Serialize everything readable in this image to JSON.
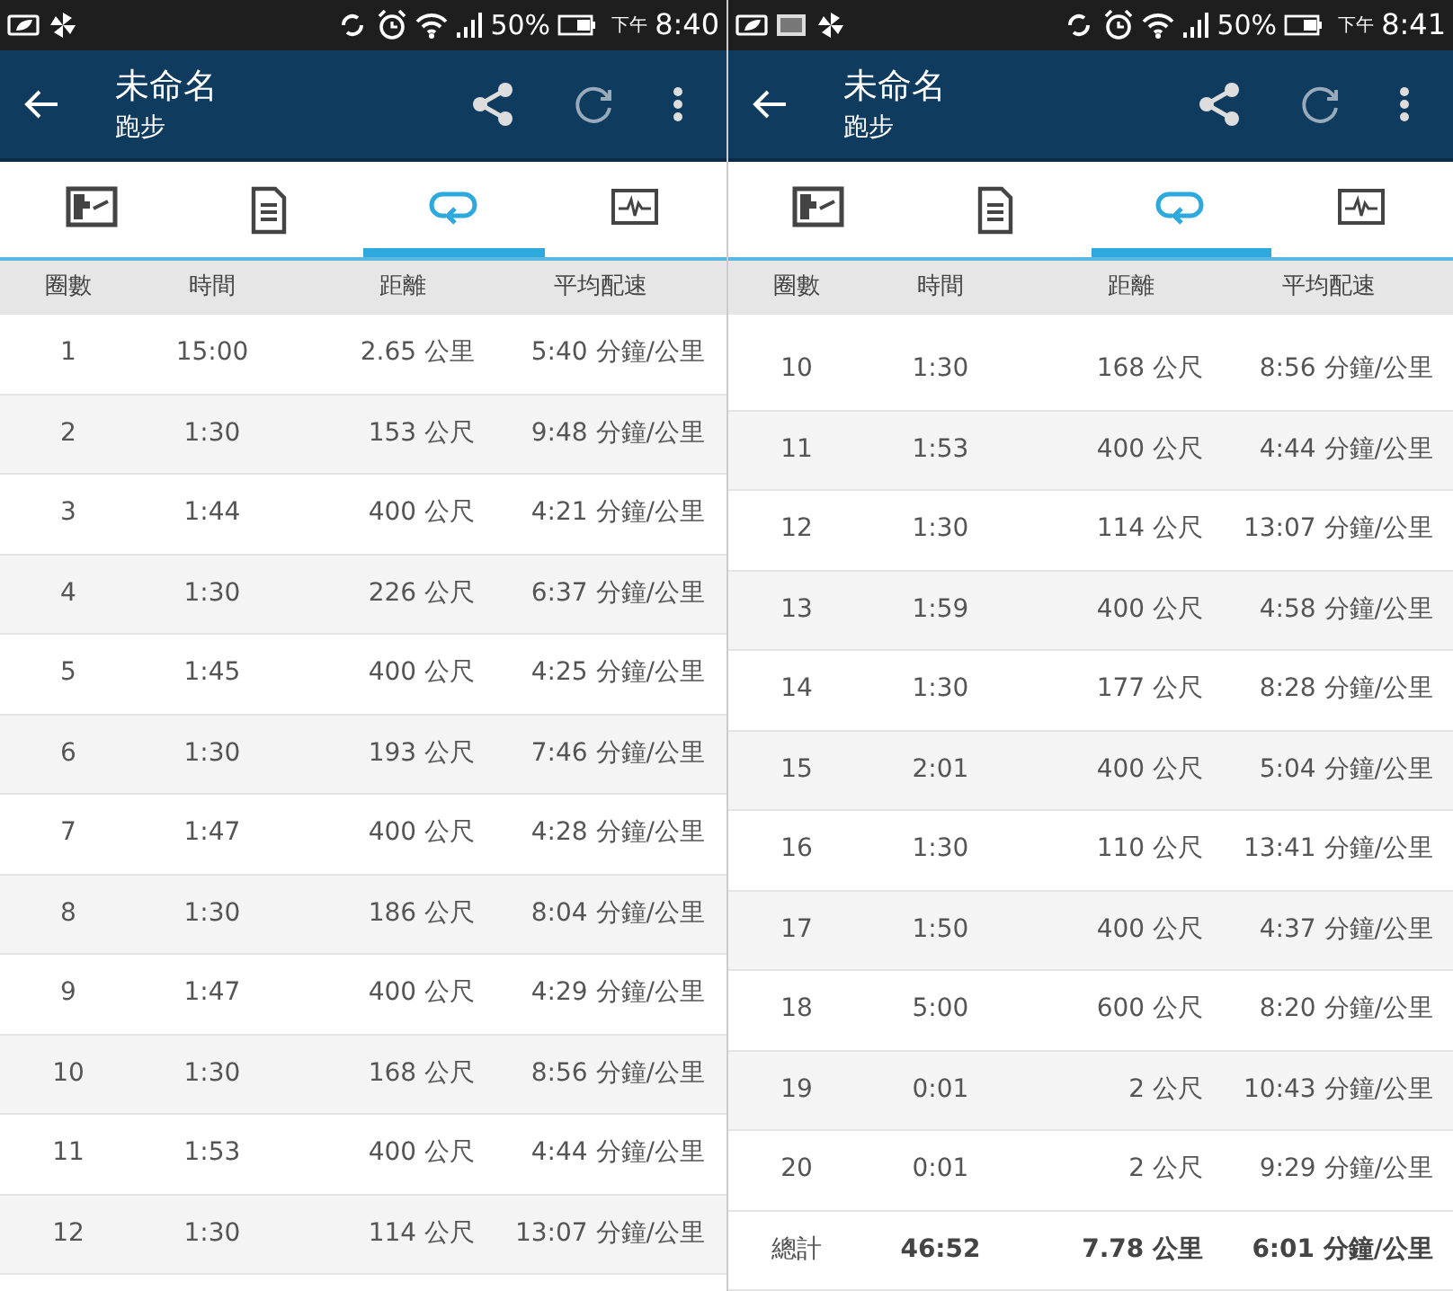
{
  "panels": [
    {
      "status_bar": {
        "notifications": [
          {
            "kind": "leaf-battery"
          },
          {
            "kind": "pinwheel"
          }
        ],
        "battery": "50%",
        "time_prefix": "下午",
        "time": "8:40"
      },
      "title": "未命名",
      "subtitle": "跑步",
      "tabs": [
        {
          "kind": "map",
          "selected": false
        },
        {
          "kind": "document",
          "selected": false
        },
        {
          "kind": "laps",
          "selected": true
        },
        {
          "kind": "chart",
          "selected": false
        }
      ],
      "columns": [
        "圈數",
        "時間",
        "距離",
        "平均配速"
      ],
      "scrolled": false,
      "rows": [
        [
          "1",
          "15:00",
          "2.65 公里",
          "5:40 分鐘/公里"
        ],
        [
          "2",
          "1:30",
          "153 公尺",
          "9:48 分鐘/公里"
        ],
        [
          "3",
          "1:44",
          "400 公尺",
          "4:21 分鐘/公里"
        ],
        [
          "4",
          "1:30",
          "226 公尺",
          "6:37 分鐘/公里"
        ],
        [
          "5",
          "1:45",
          "400 公尺",
          "4:25 分鐘/公里"
        ],
        [
          "6",
          "1:30",
          "193 公尺",
          "7:46 分鐘/公里"
        ],
        [
          "7",
          "1:47",
          "400 公尺",
          "4:28 分鐘/公里"
        ],
        [
          "8",
          "1:30",
          "186 公尺",
          "8:04 分鐘/公里"
        ],
        [
          "9",
          "1:47",
          "400 公尺",
          "4:29 分鐘/公里"
        ],
        [
          "10",
          "1:30",
          "168 公尺",
          "8:56 分鐘/公里"
        ],
        [
          "11",
          "1:53",
          "400 公尺",
          "4:44 分鐘/公里"
        ],
        [
          "12",
          "1:30",
          "114 公尺",
          "13:07 分鐘/公里"
        ]
      ]
    },
    {
      "status_bar": {
        "notifications": [
          {
            "kind": "leaf-battery"
          },
          {
            "kind": "image"
          },
          {
            "kind": "pinwheel"
          }
        ],
        "battery": "50%",
        "time_prefix": "下午",
        "time": "8:41"
      },
      "title": "未命名",
      "subtitle": "跑步",
      "tabs": [
        {
          "kind": "map",
          "selected": false
        },
        {
          "kind": "document",
          "selected": false
        },
        {
          "kind": "laps",
          "selected": true
        },
        {
          "kind": "chart",
          "selected": false
        }
      ],
      "columns": [
        "圈數",
        "時間",
        "距離",
        "平均配速"
      ],
      "scrolled": true,
      "rows": [
        [
          "10",
          "1:30",
          "168 公尺",
          "8:56 分鐘/公里"
        ],
        [
          "11",
          "1:53",
          "400 公尺",
          "4:44 分鐘/公里"
        ],
        [
          "12",
          "1:30",
          "114 公尺",
          "13:07 分鐘/公里"
        ],
        [
          "13",
          "1:59",
          "400 公尺",
          "4:58 分鐘/公里"
        ],
        [
          "14",
          "1:30",
          "177 公尺",
          "8:28 分鐘/公里"
        ],
        [
          "15",
          "2:01",
          "400 公尺",
          "5:04 分鐘/公里"
        ],
        [
          "16",
          "1:30",
          "110 公尺",
          "13:41 分鐘/公里"
        ],
        [
          "17",
          "1:50",
          "400 公尺",
          "4:37 分鐘/公里"
        ],
        [
          "18",
          "5:00",
          "600 公尺",
          "8:20 分鐘/公里"
        ],
        [
          "19",
          "0:01",
          "2 公尺",
          "10:43 分鐘/公里"
        ],
        [
          "20",
          "0:01",
          "2 公尺",
          "9:29 分鐘/公里"
        ]
      ],
      "total": [
        "總計",
        "46:52",
        "7.78 公里",
        "6:01 分鐘/公里"
      ]
    }
  ]
}
